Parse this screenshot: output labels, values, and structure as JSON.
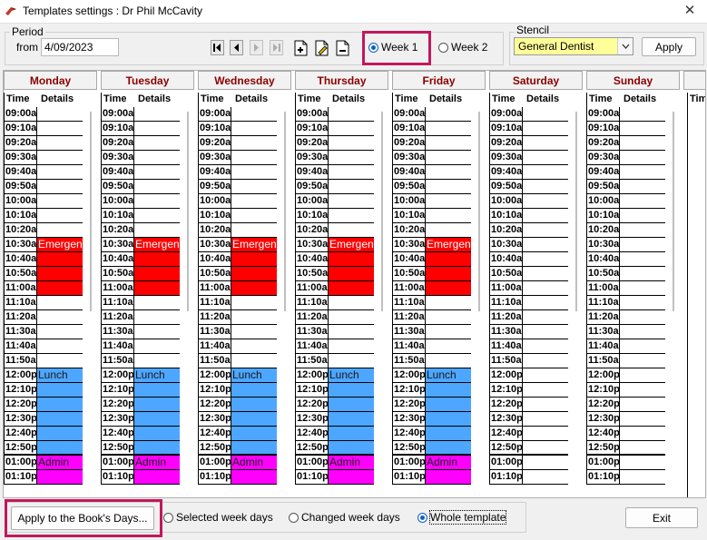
{
  "window": {
    "title": "Templates settings : Dr Phil McCavity",
    "close_icon": "close-icon"
  },
  "period": {
    "label": "Period",
    "from_label": "from",
    "from_value": "4/09/2023"
  },
  "navigation": {
    "first": "first-icon",
    "prev": "prev-icon",
    "next": "next-icon",
    "last": "last-icon"
  },
  "template_tools": {
    "add": "add-doc-icon",
    "edit": "edit-doc-icon",
    "remove": "remove-doc-icon"
  },
  "week_options": {
    "week1": "Week 1",
    "week2": "Week 2",
    "selected": "week1"
  },
  "stencil": {
    "label": "Stencil",
    "value": "General Dentist",
    "apply_label": "Apply",
    "background": "#ffff99"
  },
  "colors": {
    "emergency": "#ff0000",
    "lunch": "#4da6ff",
    "admin": "#ff00ff",
    "day_header_text": "#8b0000",
    "highlight": "#c2185b"
  },
  "schedule": {
    "headers": {
      "time": "Time",
      "details": "Details"
    },
    "days": [
      "Monday",
      "Tuesday",
      "Wednesday",
      "Thursday",
      "Friday",
      "Saturday",
      "Sunday"
    ],
    "partial_header": "Tim",
    "times": [
      "09:00a",
      "09:10a",
      "09:20a",
      "09:30a",
      "09:40a",
      "09:50a",
      "10:00a",
      "10:10a",
      "10:20a",
      "10:30a",
      "10:40a",
      "10:50a",
      "11:00a",
      "11:10a",
      "11:20a",
      "11:30a",
      "11:40a",
      "11:50a",
      "12:00p",
      "12:10p",
      "12:20p",
      "12:30p",
      "12:40p",
      "12:50p",
      "01:00p",
      "01:10p"
    ],
    "weekday_events": [
      {
        "label": "Emergency",
        "start": "10:30a",
        "end": "11:00a",
        "color": "#ff0000"
      },
      {
        "label": "Lunch",
        "start": "12:00p",
        "end": "12:50p",
        "color": "#4da6ff"
      },
      {
        "label": "Admin",
        "start": "01:00p",
        "end": "01:10p",
        "color": "#ff00ff"
      }
    ],
    "weekend_events": []
  },
  "bottom": {
    "apply_books_label": "Apply to the Book's Days...",
    "opt_selected": "Selected week days",
    "opt_changed": "Changed week days",
    "opt_whole": "Whole template",
    "selected_option": "whole",
    "exit_label": "Exit"
  }
}
